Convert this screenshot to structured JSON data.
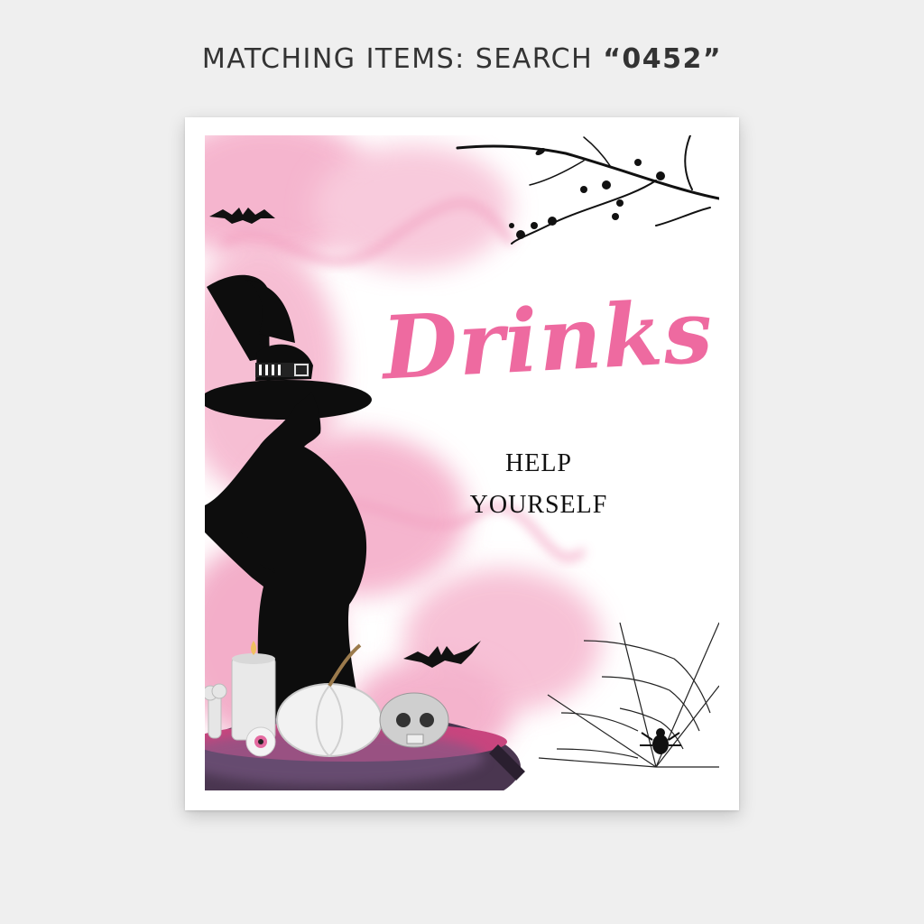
{
  "header": {
    "label": "MATCHING ITEMS: SEARCH ",
    "code": "“0452”"
  },
  "sign": {
    "title": "Drinks",
    "line1": "HELP",
    "line2": "YOURSELF"
  },
  "colors": {
    "accent": "#ee6aa0",
    "smoke": "#f4a9c6",
    "background": "#efefef"
  }
}
